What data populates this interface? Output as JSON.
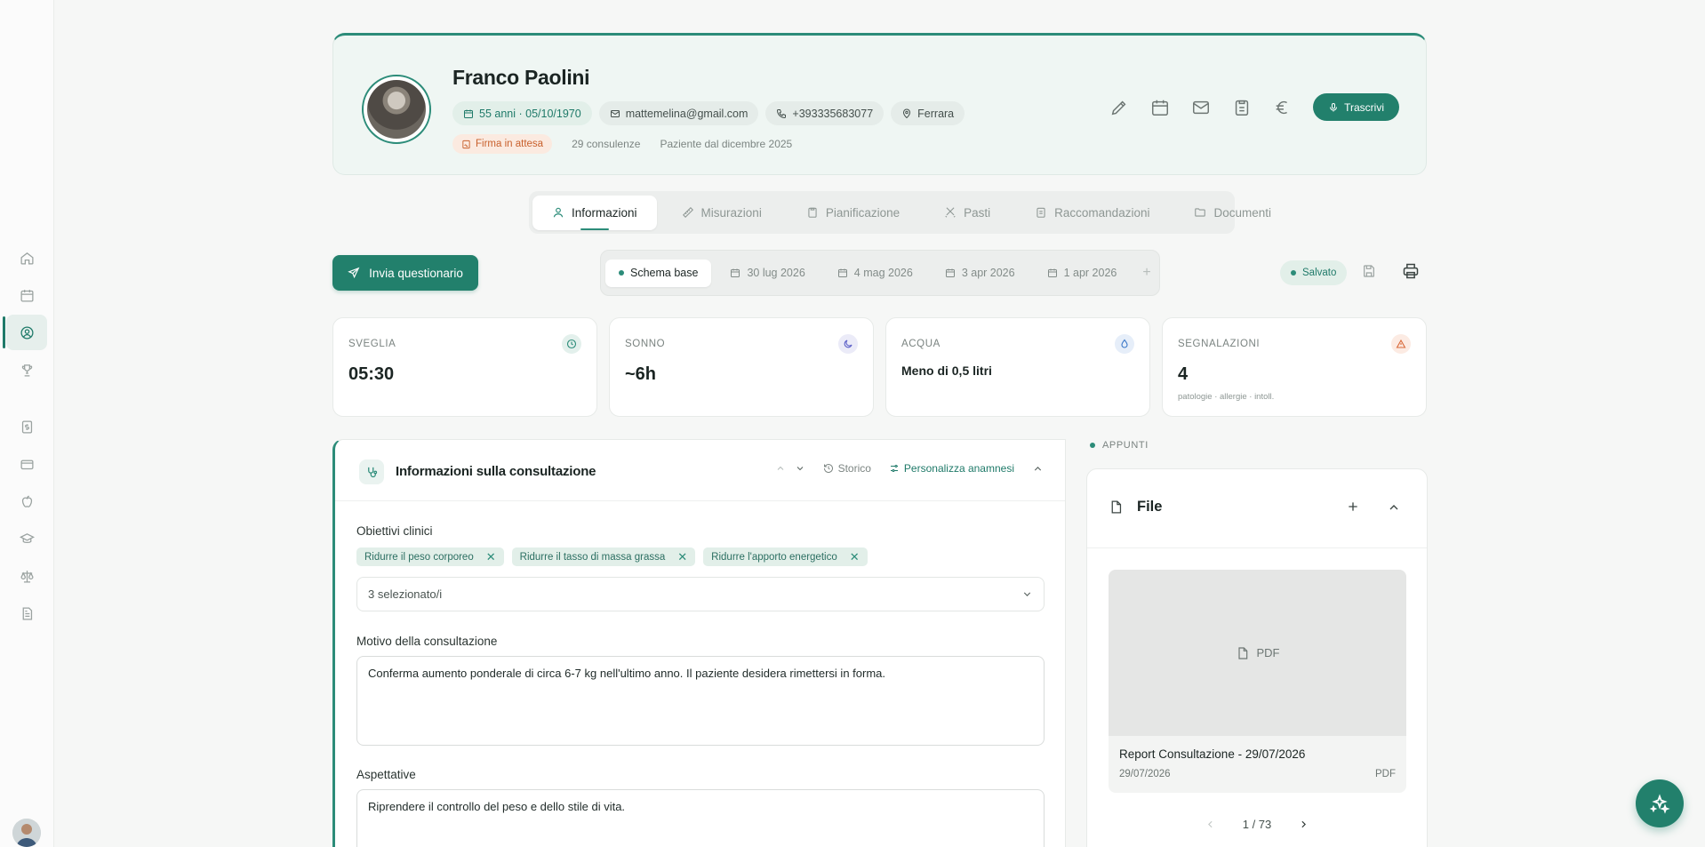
{
  "patient": {
    "name": "Franco Paolini",
    "age_dob": "55 anni · 05/10/1970",
    "email": "mattemelina@gmail.com",
    "phone": "+393335683077",
    "city": "Ferrara",
    "signature_status": "Firma in attesa",
    "consultations": "29 consulenze",
    "patient_since": "Paziente dal dicembre 2025"
  },
  "header_actions": {
    "icons": [
      "pencil-icon",
      "calendar-icon",
      "mail-icon",
      "clipboard-icon",
      "euro-icon"
    ],
    "transcribe_label": "Trascrivi"
  },
  "tabs": [
    {
      "label": "Informazioni",
      "icon": "user-icon",
      "active": true
    },
    {
      "label": "Misurazioni",
      "icon": "ruler-icon"
    },
    {
      "label": "Pianificazione",
      "icon": "clipboard-icon"
    },
    {
      "label": "Pasti",
      "icon": "utensils-icon"
    },
    {
      "label": "Raccomandazioni",
      "icon": "clipboard-list-icon"
    },
    {
      "label": "Documenti",
      "icon": "folder-icon"
    }
  ],
  "toolbar": {
    "send_questionnaire": "Invia questionario",
    "schemas": [
      "Schema base",
      "30 lug 2026",
      "4 mag 2026",
      "3 apr 2026",
      "1 apr 2026"
    ],
    "add_schema": "+",
    "saved_label": "Salvato"
  },
  "stats": [
    {
      "label": "SVEGLIA",
      "value": "05:30",
      "icon": "clock-icon",
      "color": "#2c8c79"
    },
    {
      "label": "SONNO",
      "value": "~6h",
      "icon": "moon-icon",
      "color": "#5b5fc7"
    },
    {
      "label": "ACQUA",
      "value": "Meno di 0,5 litri",
      "icon": "droplet-icon",
      "color": "#3d79c8"
    },
    {
      "label": "SEGNALAZIONI",
      "value": "4",
      "sub": "patologie · allergie · intoll.",
      "icon": "alert-triangle-icon",
      "color": "#d96a3a"
    }
  ],
  "consultation": {
    "title": "Informazioni sulla consultazione",
    "history_label": "Storico",
    "customize_label": "Personalizza anamnesi",
    "clinical_goals_label": "Obiettivi clinici",
    "clinical_goals": [
      "Ridurre il peso corporeo",
      "Ridurre il tasso di massa grassa",
      "Ridurre l'apporto energetico"
    ],
    "goals_select_value": "3 selezionato/i",
    "reason_label": "Motivo della consultazione",
    "reason_value": "Conferma aumento ponderale di circa 6-7 kg nell'ultimo anno. Il paziente desidera rimettersi in forma.",
    "expectations_label": "Aspettative",
    "expectations_value": "Riprendere il controllo del peso e dello stile di vita."
  },
  "notes": {
    "label": "APPUNTI",
    "files_title": "File",
    "file": {
      "preview_label": "PDF",
      "name": "Report Consultazione - 29/07/2026",
      "date": "29/07/2026",
      "type": "PDF"
    },
    "pager": "1 / 73"
  },
  "colors": {
    "accent": "#22806c",
    "accent_light": "#e2efe9",
    "warning": "#c8602c"
  }
}
